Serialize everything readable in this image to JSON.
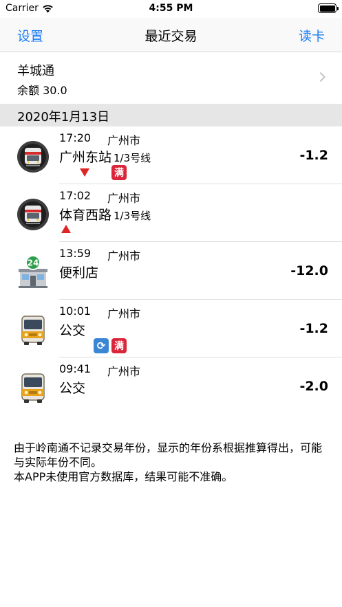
{
  "status": {
    "carrier": "Carrier",
    "time": "4:55 PM",
    "battery_level": 1.0
  },
  "nav": {
    "left": "设置",
    "title": "最近交易",
    "right": "读卡"
  },
  "card": {
    "name": "羊城通",
    "balance": "余额 30.0"
  },
  "section": {
    "date": "2020年1月13日"
  },
  "transactions": [
    {
      "time": "17:20",
      "city": "广州市",
      "station": "广州东站",
      "line": "1/3号线",
      "amount": "-1.2",
      "icon": "metro-icon",
      "badges": [
        "exit-arrow-down",
        "full-badge"
      ],
      "full_label": "满"
    },
    {
      "time": "17:02",
      "city": "广州市",
      "station": "体育西路",
      "line": "1/3号线",
      "amount": "",
      "icon": "metro-icon",
      "badges": [
        "entry-arrow-up"
      ]
    },
    {
      "time": "13:59",
      "city": "广州市",
      "station": "便利店",
      "line": "",
      "amount": "-12.0",
      "icon": "convenience-store-icon",
      "badges": [],
      "store_label": "24"
    },
    {
      "time": "10:01",
      "city": "广州市",
      "station": "公交",
      "line": "",
      "amount": "-1.2",
      "icon": "bus-icon",
      "badges": [
        "transfer-badge",
        "full-badge"
      ],
      "full_label": "满"
    },
    {
      "time": "09:41",
      "city": "广州市",
      "station": "公交",
      "line": "",
      "amount": "-2.0",
      "icon": "bus-icon",
      "badges": []
    }
  ],
  "footer": {
    "line1": "由于岭南通不记录交易年份，显示的年份系根据推算得出，可能与实际年份不同。",
    "line2": "本APP未使用官方数据库，结果可能不准确。"
  },
  "colors": {
    "accent": "#1a7cf5",
    "section_bg": "#e6e6e6",
    "arrow_red": "#e02424",
    "full_badge": "#d9263a",
    "transfer_badge": "#3b86d4"
  }
}
